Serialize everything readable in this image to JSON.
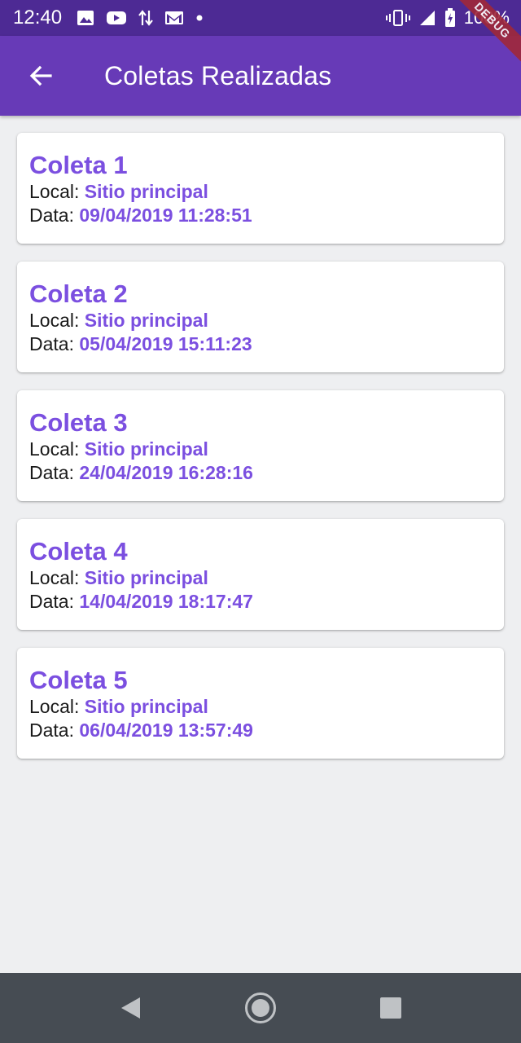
{
  "status_bar": {
    "time": "12:40",
    "battery": "100%",
    "left_icons": [
      "image-icon",
      "youtube-icon",
      "data-transfer-icon",
      "gmail-icon",
      "notification-dot-icon"
    ],
    "right_icons": [
      "vibrate-icon",
      "signal-icon",
      "battery-charging-icon"
    ]
  },
  "app_bar": {
    "title": "Coletas Realizadas",
    "back_icon": "arrow-left-icon",
    "debug_label": "DEBUG"
  },
  "colors": {
    "app_bar": "#673ab7",
    "status_bar": "#4d2a94",
    "accent": "#7b4fe0",
    "background": "#eeeff1",
    "nav_bar": "#464c53"
  },
  "labels": {
    "local": "Local: ",
    "data": "Data: "
  },
  "coletas": [
    {
      "title": "Coleta 1",
      "local": "Sitio principal",
      "data": "09/04/2019 11:28:51"
    },
    {
      "title": "Coleta 2",
      "local": "Sitio principal",
      "data": "05/04/2019 15:11:23"
    },
    {
      "title": "Coleta 3",
      "local": "Sitio principal",
      "data": "24/04/2019 16:28:16"
    },
    {
      "title": "Coleta 4",
      "local": "Sitio principal",
      "data": "14/04/2019 18:17:47"
    },
    {
      "title": "Coleta 5",
      "local": "Sitio principal",
      "data": "06/04/2019 13:57:49"
    }
  ],
  "nav_bar": {
    "buttons": [
      "back-triangle-icon",
      "home-circle-icon",
      "recents-square-icon"
    ]
  }
}
